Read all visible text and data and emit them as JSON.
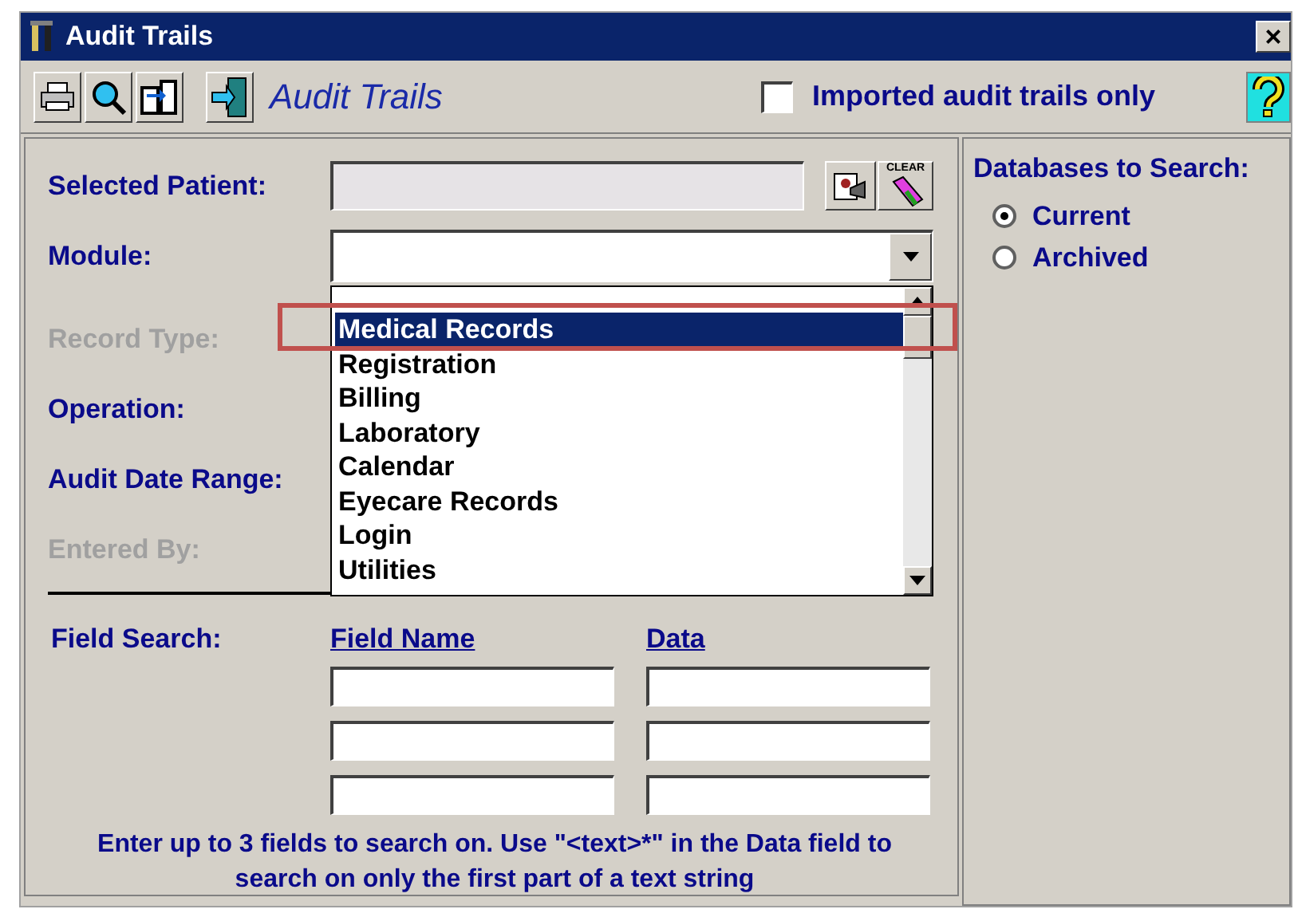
{
  "window": {
    "title": "Audit Trails",
    "close": "×"
  },
  "toolbar": {
    "title": "Audit Trails",
    "imported_only": {
      "label": "Imported audit trails only",
      "checked": false
    }
  },
  "form": {
    "selected_patient": {
      "label": "Selected Patient:",
      "clear_label": "CLEAR"
    },
    "module": {
      "label": "Module:"
    },
    "rows": [
      {
        "label": "Record Type:",
        "disabled": true
      },
      {
        "label": "Operation:",
        "disabled": false
      },
      {
        "label": "Audit Date Range:",
        "disabled": false
      },
      {
        "label": "Entered By:",
        "disabled": true
      }
    ]
  },
  "module_list": {
    "items": [
      {
        "label": "Medical Records",
        "selected": true
      },
      {
        "label": "Registration",
        "selected": false
      },
      {
        "label": "Billing",
        "selected": false
      },
      {
        "label": "Laboratory",
        "selected": false
      },
      {
        "label": "Calendar",
        "selected": false
      },
      {
        "label": "Eyecare Records",
        "selected": false
      },
      {
        "label": "Login",
        "selected": false
      },
      {
        "label": "Utilities",
        "selected": false
      }
    ]
  },
  "field_search": {
    "label": "Field Search:",
    "columns": [
      "Field Name",
      "Data"
    ],
    "hint": "Enter up to 3 fields to search on. Use \"<text>*\" in the Data field to search on only the first part of a text string"
  },
  "databases": {
    "title": "Databases to Search:",
    "options": [
      {
        "label": "Current",
        "selected": true
      },
      {
        "label": "Archived",
        "selected": false
      }
    ]
  }
}
